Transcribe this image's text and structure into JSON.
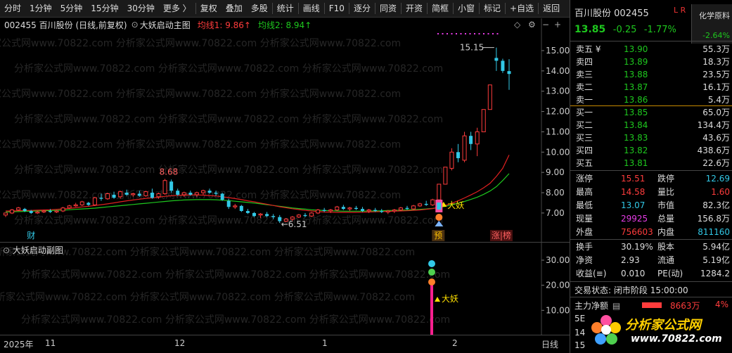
{
  "toolbar": {
    "items": [
      "分时",
      "1分钟",
      "5分钟",
      "15分钟",
      "30分钟",
      "更多 〉",
      "复权",
      "叠加",
      "多股",
      "统计",
      "画线",
      "F10",
      "逐分",
      "同资",
      "开资",
      "简框",
      "小窗",
      "标记",
      "+自选",
      "返回"
    ]
  },
  "chart_header": {
    "code_name": "002455 百川股份 (日线,前复权)",
    "indicator": "大妖启动主图",
    "ma1": "均线1: 9.86↑",
    "ma2": "均线2: 8.94↑"
  },
  "sub_chart": {
    "title": "大妖启动副图",
    "signal_label": "大妖",
    "y_ticks": [
      "30.00",
      "20.00",
      "10.00"
    ]
  },
  "watermark": "分析家公式网www.70822.com",
  "time_axis": {
    "labels": [
      "2025年",
      "11",
      "12",
      "1",
      "2"
    ],
    "period": "日线"
  },
  "chart_data": {
    "type": "candlestick",
    "y_ticks": [
      "15.00",
      "14.00",
      "13.00",
      "12.00",
      "11.00",
      "10.00",
      "9.00",
      "8.00",
      "7.00"
    ],
    "ylim": [
      6.2,
      15.9
    ],
    "annotations": {
      "high_label": "8.68",
      "low_label": "←6.51",
      "peak_label": "15.15",
      "signal_label": "大妖",
      "tag_cai": "财",
      "tag_yu": "预",
      "tag_zhangting": "涨|榜"
    },
    "candles": [
      [
        6.9,
        7.0,
        6.8,
        7.0
      ],
      [
        7.0,
        7.2,
        6.95,
        7.15
      ],
      [
        7.15,
        7.3,
        7.1,
        7.25
      ],
      [
        7.2,
        7.25,
        7.05,
        7.1
      ],
      [
        7.1,
        7.15,
        6.95,
        7.0
      ],
      [
        7.0,
        7.1,
        6.95,
        7.05
      ],
      [
        7.05,
        7.15,
        7.0,
        7.1
      ],
      [
        7.1,
        7.2,
        7.0,
        7.05
      ],
      [
        7.05,
        7.15,
        7.0,
        7.1
      ],
      [
        7.1,
        7.3,
        7.05,
        7.25
      ],
      [
        7.25,
        7.4,
        7.2,
        7.35
      ],
      [
        7.35,
        7.5,
        7.3,
        7.4
      ],
      [
        7.4,
        7.6,
        7.35,
        7.55
      ],
      [
        7.5,
        7.55,
        7.35,
        7.4
      ],
      [
        7.4,
        7.8,
        7.35,
        7.75
      ],
      [
        7.75,
        7.95,
        7.6,
        7.7
      ],
      [
        7.7,
        8.0,
        7.65,
        7.95
      ],
      [
        7.9,
        8.05,
        7.7,
        7.75
      ],
      [
        7.8,
        8.1,
        7.7,
        8.05
      ],
      [
        8.0,
        8.15,
        7.85,
        7.9
      ],
      [
        7.9,
        8.0,
        7.8,
        7.95
      ],
      [
        7.95,
        8.1,
        7.8,
        7.85
      ],
      [
        7.85,
        8.1,
        7.8,
        8.05
      ],
      [
        8.0,
        8.2,
        7.7,
        7.75
      ],
      [
        7.8,
        8.0,
        7.7,
        7.95
      ],
      [
        7.95,
        8.68,
        7.9,
        8.6
      ],
      [
        8.55,
        8.65,
        8.0,
        8.1
      ],
      [
        8.1,
        8.2,
        7.85,
        7.9
      ],
      [
        7.9,
        8.05,
        7.8,
        8.0
      ],
      [
        8.0,
        8.1,
        7.85,
        7.9
      ],
      [
        7.9,
        8.05,
        7.8,
        8.0
      ],
      [
        8.0,
        8.15,
        7.9,
        8.1
      ],
      [
        8.1,
        8.2,
        7.95,
        8.0
      ],
      [
        8.0,
        8.1,
        7.85,
        7.95
      ],
      [
        7.95,
        8.0,
        7.6,
        7.65
      ],
      [
        7.6,
        7.7,
        7.2,
        7.3
      ],
      [
        7.3,
        7.45,
        7.2,
        7.35
      ],
      [
        7.35,
        7.4,
        7.05,
        7.1
      ],
      [
        7.1,
        7.2,
        6.95,
        7.0
      ],
      [
        7.0,
        7.05,
        6.8,
        6.85
      ],
      [
        6.9,
        7.0,
        6.75,
        6.95
      ],
      [
        6.95,
        7.05,
        6.8,
        6.85
      ],
      [
        6.85,
        6.95,
        6.7,
        6.8
      ],
      [
        6.8,
        6.9,
        6.51,
        6.6
      ],
      [
        6.6,
        6.75,
        6.55,
        6.7
      ],
      [
        6.7,
        6.85,
        6.6,
        6.8
      ],
      [
        6.8,
        6.95,
        6.75,
        6.9
      ],
      [
        6.9,
        7.0,
        6.8,
        6.85
      ],
      [
        6.85,
        7.05,
        6.8,
        7.0
      ],
      [
        7.0,
        7.2,
        6.95,
        7.15
      ],
      [
        7.15,
        7.25,
        7.05,
        7.1
      ],
      [
        7.1,
        7.2,
        7.0,
        7.15
      ],
      [
        7.15,
        7.35,
        7.1,
        7.3
      ],
      [
        7.3,
        7.4,
        7.15,
        7.2
      ],
      [
        7.2,
        7.3,
        7.1,
        7.25
      ],
      [
        7.25,
        7.35,
        7.15,
        7.2
      ],
      [
        7.2,
        7.3,
        7.05,
        7.1
      ],
      [
        7.1,
        7.2,
        7.0,
        7.15
      ],
      [
        7.15,
        7.25,
        7.05,
        7.1
      ],
      [
        7.1,
        7.2,
        7.0,
        7.05
      ],
      [
        7.05,
        7.15,
        6.95,
        7.1
      ],
      [
        7.1,
        7.2,
        7.0,
        7.15
      ],
      [
        7.15,
        7.3,
        7.1,
        7.25
      ],
      [
        7.25,
        7.35,
        7.15,
        7.2
      ],
      [
        7.2,
        7.4,
        7.15,
        7.35
      ],
      [
        7.35,
        7.5,
        7.3,
        7.45
      ],
      [
        7.45,
        7.6,
        7.35,
        7.4
      ],
      [
        7.4,
        7.7,
        7.35,
        7.65
      ],
      [
        7.65,
        8.42,
        7.6,
        8.42
      ],
      [
        8.42,
        9.26,
        8.4,
        9.26
      ],
      [
        9.2,
        10.19,
        9.1,
        10.0
      ],
      [
        10.0,
        10.4,
        9.5,
        9.7
      ],
      [
        9.6,
        11.0,
        9.5,
        10.8
      ],
      [
        10.8,
        11.0,
        10.1,
        10.4
      ],
      [
        10.4,
        11.2,
        9.8,
        11.0
      ],
      [
        11.0,
        12.1,
        11.0,
        12.1
      ],
      [
        12.1,
        13.31,
        12.1,
        13.31
      ],
      [
        14.64,
        15.15,
        14.0,
        14.5
      ],
      [
        14.5,
        14.6,
        13.9,
        14.0
      ],
      [
        13.99,
        14.58,
        13.07,
        13.85
      ]
    ],
    "ma1": [
      7.1,
      7.1,
      7.11,
      7.12,
      7.13,
      7.14,
      7.15,
      7.16,
      7.18,
      7.2,
      7.23,
      7.26,
      7.3,
      7.33,
      7.37,
      7.41,
      7.45,
      7.5,
      7.55,
      7.6,
      7.64,
      7.68,
      7.72,
      7.75,
      7.78,
      7.82,
      7.85,
      7.87,
      7.88,
      7.89,
      7.89,
      7.88,
      7.86,
      7.84,
      7.8,
      7.76,
      7.71,
      7.66,
      7.6,
      7.55,
      7.49,
      7.43,
      7.37,
      7.31,
      7.26,
      7.21,
      7.17,
      7.13,
      7.1,
      7.07,
      7.05,
      7.04,
      7.03,
      7.03,
      7.03,
      7.03,
      7.04,
      7.05,
      7.06,
      7.07,
      7.08,
      7.09,
      7.1,
      7.11,
      7.13,
      7.15,
      7.18,
      7.22,
      7.28,
      7.37,
      7.48,
      7.6,
      7.74,
      7.89,
      8.05,
      8.24,
      8.46,
      8.8,
      9.2,
      9.86
    ],
    "ma2": [
      7.05,
      7.06,
      7.07,
      7.08,
      7.09,
      7.1,
      7.11,
      7.12,
      7.13,
      7.14,
      7.16,
      7.18,
      7.2,
      7.22,
      7.24,
      7.27,
      7.3,
      7.33,
      7.36,
      7.39,
      7.42,
      7.45,
      7.48,
      7.51,
      7.54,
      7.57,
      7.6,
      7.62,
      7.64,
      7.65,
      7.66,
      7.66,
      7.66,
      7.65,
      7.63,
      7.61,
      7.58,
      7.55,
      7.52,
      7.49,
      7.45,
      7.41,
      7.37,
      7.33,
      7.29,
      7.25,
      7.22,
      7.19,
      7.16,
      7.14,
      7.12,
      7.11,
      7.1,
      7.09,
      7.09,
      7.09,
      7.09,
      7.1,
      7.1,
      7.11,
      7.12,
      7.13,
      7.14,
      7.15,
      7.16,
      7.18,
      7.2,
      7.23,
      7.27,
      7.33,
      7.4,
      7.48,
      7.57,
      7.67,
      7.78,
      7.92,
      8.08,
      8.3,
      8.6,
      8.94
    ]
  },
  "quote": {
    "name": "百川股份",
    "code": "002455",
    "lr": "L R",
    "sector_name": "化学原料",
    "sector_change": "-2.64%",
    "price": "13.85",
    "change": "-0.25",
    "change_pct": "-1.77%",
    "asks": [
      {
        "label": "卖五 ¥",
        "price": "13.90",
        "vol": "55.3万"
      },
      {
        "label": "卖四",
        "price": "13.89",
        "vol": "18.3万"
      },
      {
        "label": "卖三",
        "price": "13.88",
        "vol": "23.5万"
      },
      {
        "label": "卖二",
        "price": "13.87",
        "vol": "16.1万"
      },
      {
        "label": "卖一",
        "price": "13.86",
        "vol": "5.4万"
      }
    ],
    "bids": [
      {
        "label": "买一",
        "price": "13.85",
        "vol": "65.0万"
      },
      {
        "label": "买二",
        "price": "13.84",
        "vol": "134.4万"
      },
      {
        "label": "买三",
        "price": "13.83",
        "vol": "43.6万"
      },
      {
        "label": "买四",
        "price": "13.82",
        "vol": "438.6万"
      },
      {
        "label": "买五",
        "price": "13.81",
        "vol": "22.6万"
      }
    ],
    "stats": [
      {
        "l1": "涨停",
        "v1": "15.51",
        "c1": "red",
        "l2": "跌停",
        "v2": "12.69",
        "c2": "cyan"
      },
      {
        "l1": "最高",
        "v1": "14.58",
        "c1": "red",
        "l2": "量比",
        "v2": "1.60",
        "c2": "red"
      },
      {
        "l1": "最低",
        "v1": "13.07",
        "c1": "cyan",
        "l2": "市值",
        "v2": "82.3亿",
        "c2": "white"
      },
      {
        "l1": "现量",
        "v1": "29925",
        "c1": "magenta",
        "l2": "总量",
        "v2": "156.8万",
        "c2": "white"
      },
      {
        "l1": "外盘",
        "v1": "756603",
        "c1": "red",
        "l2": "内盘",
        "v2": "811160",
        "c2": "cyan"
      }
    ],
    "fund": [
      {
        "l1": "换手",
        "v1": "30.19%",
        "l2": "股本",
        "v2": "5.94亿"
      },
      {
        "l1": "净资",
        "v1": "2.93",
        "l2": "流通",
        "v2": "5.19亿"
      },
      {
        "l1": "收益(≡)",
        "v1": "0.010",
        "l2": "PE(动)",
        "v2": "1284.2"
      }
    ],
    "status_label": "交易状态:",
    "status_value": "闭市阶段 15:00:00",
    "main_flow_label": "主力净额",
    "main_flow_value": "8663万",
    "main_flow_pct": "4%",
    "bottom_labels": [
      "5E",
      "14",
      "15"
    ]
  },
  "logo": {
    "text": "分析家公式网",
    "url": "www.70822.com"
  }
}
